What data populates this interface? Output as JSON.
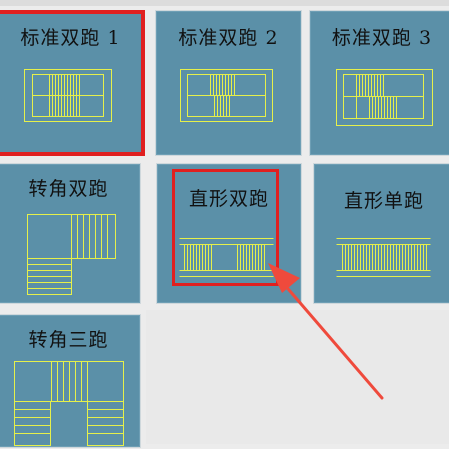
{
  "header": {
    "clipped_text": ""
  },
  "tiles": [
    {
      "label": "标准双跑 1",
      "icon": "standard-double-run-1-icon"
    },
    {
      "label": "标准双跑 2",
      "icon": "standard-double-run-2-icon"
    },
    {
      "label": "标准双跑 3",
      "icon": "standard-double-run-3-icon"
    },
    {
      "label": "转角双跑",
      "icon": "corner-double-run-icon"
    },
    {
      "label": "直形双跑",
      "icon": "straight-double-run-icon"
    },
    {
      "label": "直形单跑",
      "icon": "straight-single-run-icon"
    },
    {
      "label": "转角三跑",
      "icon": "corner-triple-run-icon"
    }
  ],
  "colors": {
    "tile_bg": "#5b90a8",
    "drawing_line": "#e6f04a",
    "selection_red": "#e02020",
    "annotation_arrow": "#ef4a3c",
    "label_text": "#111111"
  },
  "selected_tile": "标准双跑 1",
  "annotated_tile": "直形双跑"
}
